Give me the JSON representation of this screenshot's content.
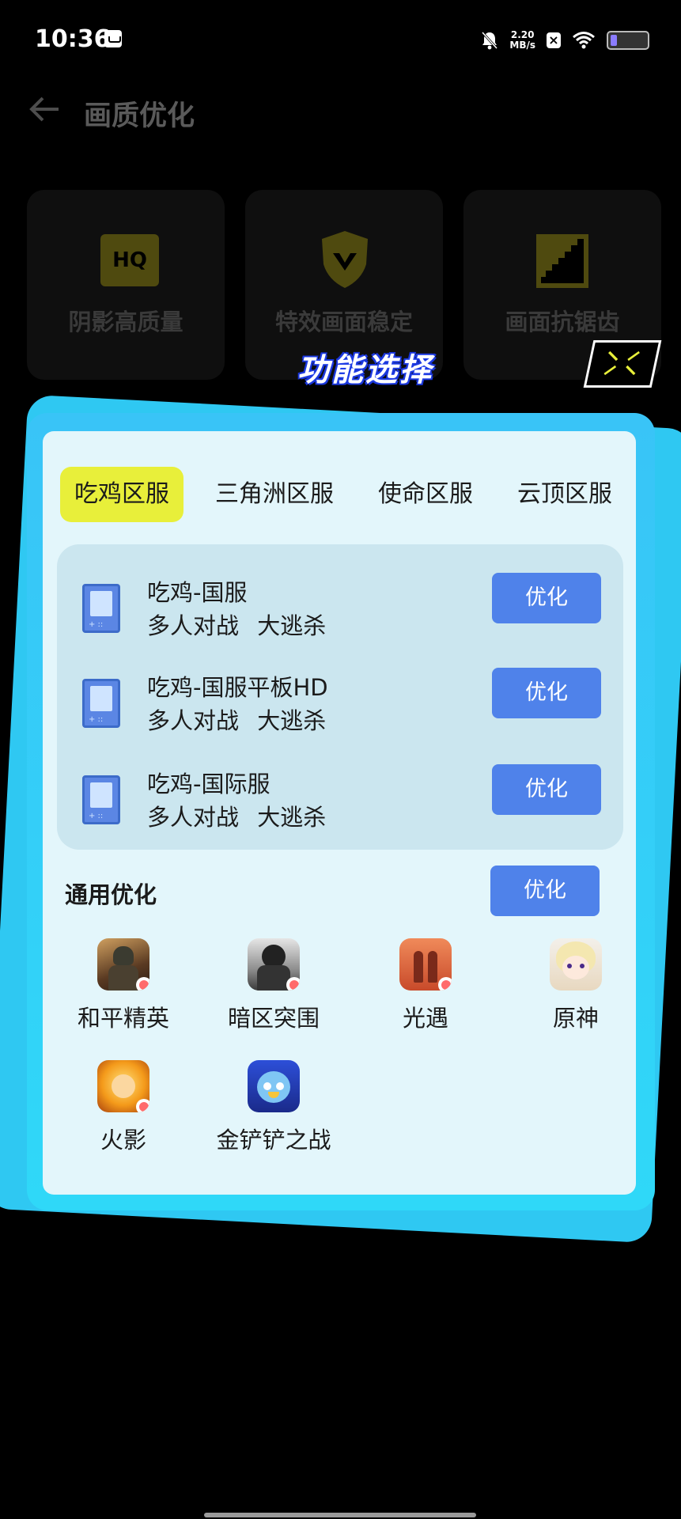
{
  "status_bar": {
    "time": "10:36",
    "net_speed_value": "2.20",
    "net_speed_unit": "MB/s",
    "battery_color": "#8b7cff"
  },
  "header": {
    "title": "画质优化"
  },
  "feature_cards": [
    {
      "label": "阴影高质量",
      "icon": "hq-icon",
      "icon_text": "HQ"
    },
    {
      "label": "特效画面稳定",
      "icon": "shield-icon"
    },
    {
      "label": "画面抗锯齿",
      "icon": "antialias-icon"
    }
  ],
  "dialog": {
    "title": "功能选择",
    "tabs": [
      {
        "label": "吃鸡区服",
        "active": true
      },
      {
        "label": "三角洲区服",
        "active": false
      },
      {
        "label": "使命区服",
        "active": false
      },
      {
        "label": "云顶区服",
        "active": false
      }
    ],
    "servers": [
      {
        "name": "吃鸡-国服",
        "tags": "多人对战 大逃杀",
        "button": "优化"
      },
      {
        "name": "吃鸡-国服平板HD",
        "tags": "多人对战 大逃杀",
        "button": "优化"
      },
      {
        "name": "吃鸡-国际服",
        "tags": "多人对战 大逃杀",
        "button": "优化"
      }
    ],
    "general": {
      "label": "通用优化",
      "button": "优化"
    },
    "apps": [
      {
        "name": "和平精英"
      },
      {
        "name": "暗区突围"
      },
      {
        "name": "光遇"
      },
      {
        "name": "原神"
      },
      {
        "name": "火影"
      },
      {
        "name": "金铲铲之战"
      }
    ]
  },
  "colors": {
    "accent_yellow": "#e8ef3a",
    "button_blue": "#4f82ea",
    "panel_cyan": "#39cbf8"
  }
}
